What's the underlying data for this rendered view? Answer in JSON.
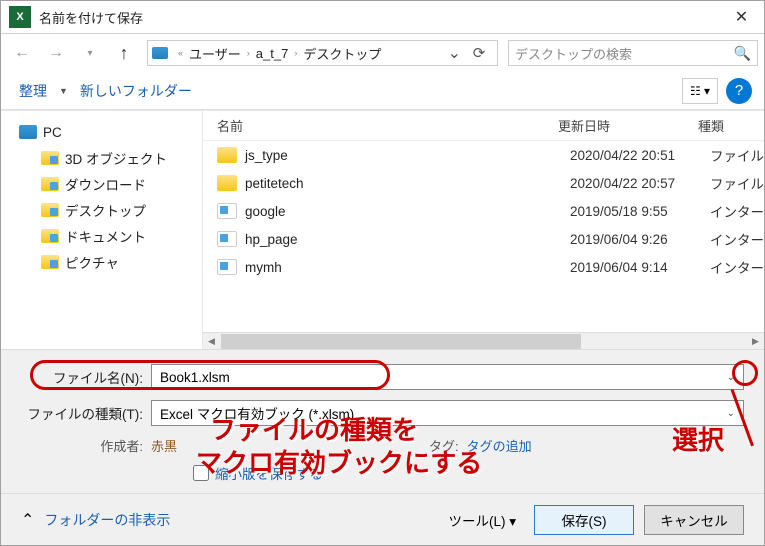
{
  "title": "名前を付けて保存",
  "breadcrumb": {
    "sep_first": "«",
    "a": "ユーザー",
    "b": "a_t_7",
    "c": "デスクトップ"
  },
  "search_placeholder": "デスクトップの検索",
  "toolbar": {
    "organize": "整理",
    "newfolder": "新しいフォルダー"
  },
  "sidebar": {
    "pc": "PC",
    "items": [
      "3D オブジェクト",
      "ダウンロード",
      "デスクトップ",
      "ドキュメント",
      "ピクチャ"
    ]
  },
  "columns": {
    "name": "名前",
    "date": "更新日時",
    "type": "種類"
  },
  "rows": [
    {
      "name": "js_type",
      "date": "2020/04/22 20:51",
      "type": "ファイル",
      "kind": "folder"
    },
    {
      "name": "petitetech",
      "date": "2020/04/22 20:57",
      "type": "ファイル",
      "kind": "folder"
    },
    {
      "name": "google",
      "date": "2019/05/18 9:55",
      "type": "インター",
      "kind": "file"
    },
    {
      "name": "hp_page",
      "date": "2019/06/04 9:26",
      "type": "インター",
      "kind": "file"
    },
    {
      "name": "mymh",
      "date": "2019/06/04 9:14",
      "type": "インター",
      "kind": "file"
    }
  ],
  "form": {
    "filename_label": "ファイル名(N):",
    "filename_value": "Book1.xlsm",
    "filetype_label": "ファイルの種類(T):",
    "filetype_value": "Excel マクロ有効ブック (*.xlsm)",
    "author_label": "作成者:",
    "author_value": "赤黒",
    "tag_label": "タグ:",
    "tag_value": "タグの追加",
    "thumb_label": "縮小版を保存する"
  },
  "footer": {
    "hide": "フォルダーの非表示",
    "tools": "ツール(L)",
    "save": "保存(S)",
    "cancel": "キャンセル"
  },
  "annotations": {
    "line1": "ファイルの種類を",
    "line2": "マクロ有効ブックにする",
    "select": "選択"
  }
}
